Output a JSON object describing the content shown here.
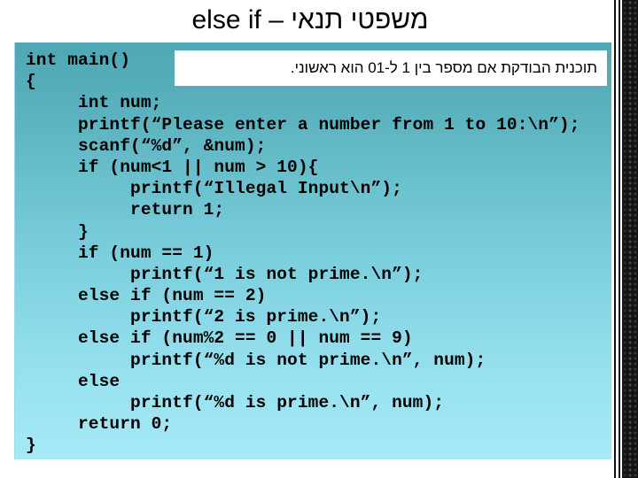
{
  "slide": {
    "title": "משפטי תנאי – else if",
    "caption": "תוכנית הבודקת אם מספר בין 1 ל-10  הוא ראשוני.",
    "colors": {
      "panel_top": "#4ea7b4",
      "panel_bottom": "#a6e9f6",
      "caption_bg": "#ffffff",
      "text": "#000000",
      "edge_strip": "#141414"
    },
    "code_lines": [
      "int main()",
      "{",
      "     int num;",
      "     printf(“Please enter a number from 1 to 10:\\n”);",
      "     scanf(“%d”, &num);",
      "     if (num<1 || num > 10){",
      "          printf(“Illegal Input\\n”);",
      "          return 1;",
      "     }",
      "     if (num == 1)",
      "          printf(“1 is not prime.\\n”);",
      "     else if (num == 2)",
      "          printf(“2 is prime.\\n”);",
      "     else if (num%2 == 0 || num == 9)",
      "          printf(“%d is not prime.\\n”, num);",
      "     else",
      "          printf(“%d is prime.\\n”, num);",
      "     return 0;",
      "}"
    ]
  }
}
